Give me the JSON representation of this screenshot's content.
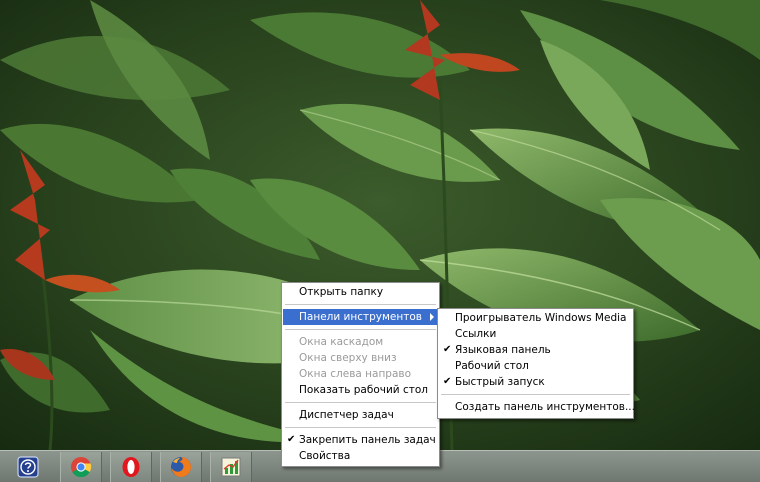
{
  "taskbar": {
    "buttons": [
      {
        "name": "help-icon"
      },
      {
        "name": "chrome-icon"
      },
      {
        "name": "opera-icon"
      },
      {
        "name": "firefox-icon"
      },
      {
        "name": "chart-app-icon"
      }
    ]
  },
  "context_menu": {
    "items": [
      {
        "label": "Открыть папку",
        "state": "normal"
      },
      {
        "label": "Панели инструментов",
        "state": "highlighted",
        "submenu": true
      },
      {
        "label": "Окна каскадом",
        "state": "disabled"
      },
      {
        "label": "Окна сверху вниз",
        "state": "disabled"
      },
      {
        "label": "Окна слева направо",
        "state": "disabled"
      },
      {
        "label": "Показать рабочий стол",
        "state": "normal"
      },
      {
        "label": "Диспетчер задач",
        "state": "normal"
      },
      {
        "label": "Закрепить панель задач",
        "state": "checked"
      },
      {
        "label": "Свойства",
        "state": "normal"
      }
    ]
  },
  "toolbars_submenu": {
    "items": [
      {
        "label": "Проигрыватель Windows Media",
        "checked": false
      },
      {
        "label": "Ссылки",
        "checked": false
      },
      {
        "label": "Языковая панель",
        "checked": true
      },
      {
        "label": "Рабочий стол",
        "checked": false
      },
      {
        "label": "Быстрый запуск",
        "checked": true
      },
      {
        "label": "Создать панель инструментов...",
        "checked": false
      }
    ]
  },
  "colors": {
    "highlight": "#3a6fcf",
    "disabled_text": "#9a9a9a",
    "taskbar": "#7e877f"
  }
}
